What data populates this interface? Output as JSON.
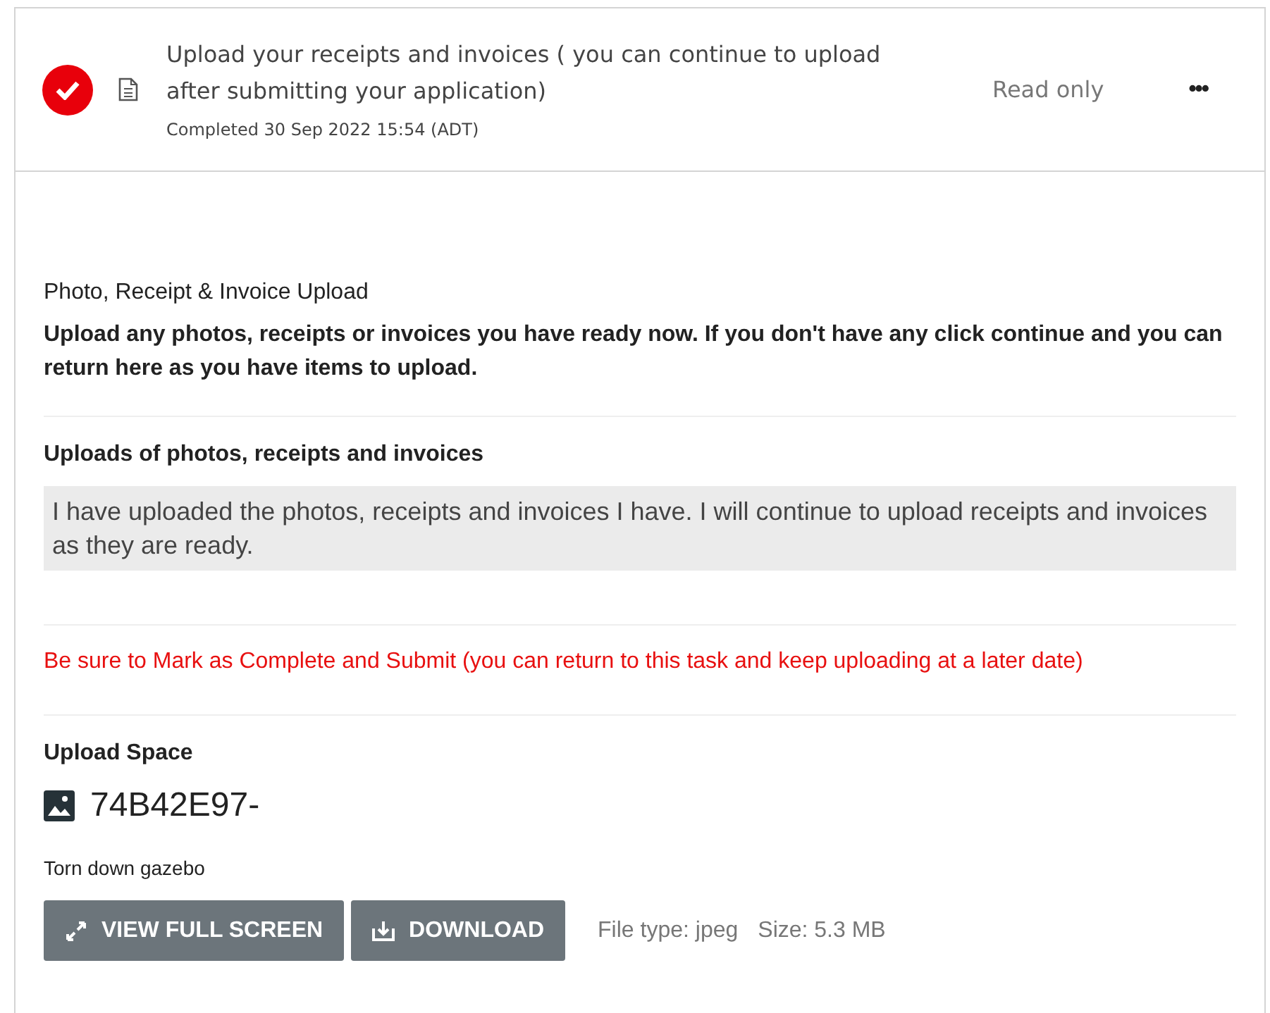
{
  "task": {
    "completed": true,
    "title": "Upload your receipts and invoices ( you can continue to upload after submitting your application)",
    "completed_text": "Completed 30 Sep 2022 15:54 (ADT)",
    "access": "Read only",
    "menu": "•••"
  },
  "section": {
    "label": "Photo, Receipt & Invoice Upload",
    "instructions": "Upload any photos, receipts or invoices you have ready now. If you don't have any click continue and you can return here as you have items to upload."
  },
  "answer": {
    "label": "Uploads of photos, receipts and invoices",
    "value": "I have uploaded the photos, receipts and invoices I have. I will continue to upload receipts and invoices as they are ready."
  },
  "warning": "Be sure to Mark as Complete and Submit (you can return to this task and keep uploading at a later date)",
  "upload": {
    "label": "Upload Space",
    "file_name": "74B42E97-",
    "caption": "Torn down gazebo",
    "buttons": [
      {
        "kind": "fullscreen",
        "label": "VIEW FULL SCREEN"
      },
      {
        "kind": "download",
        "label": "DOWNLOAD"
      }
    ],
    "file_type": "File type: jpeg",
    "size": "Size: 5.3 MB"
  }
}
